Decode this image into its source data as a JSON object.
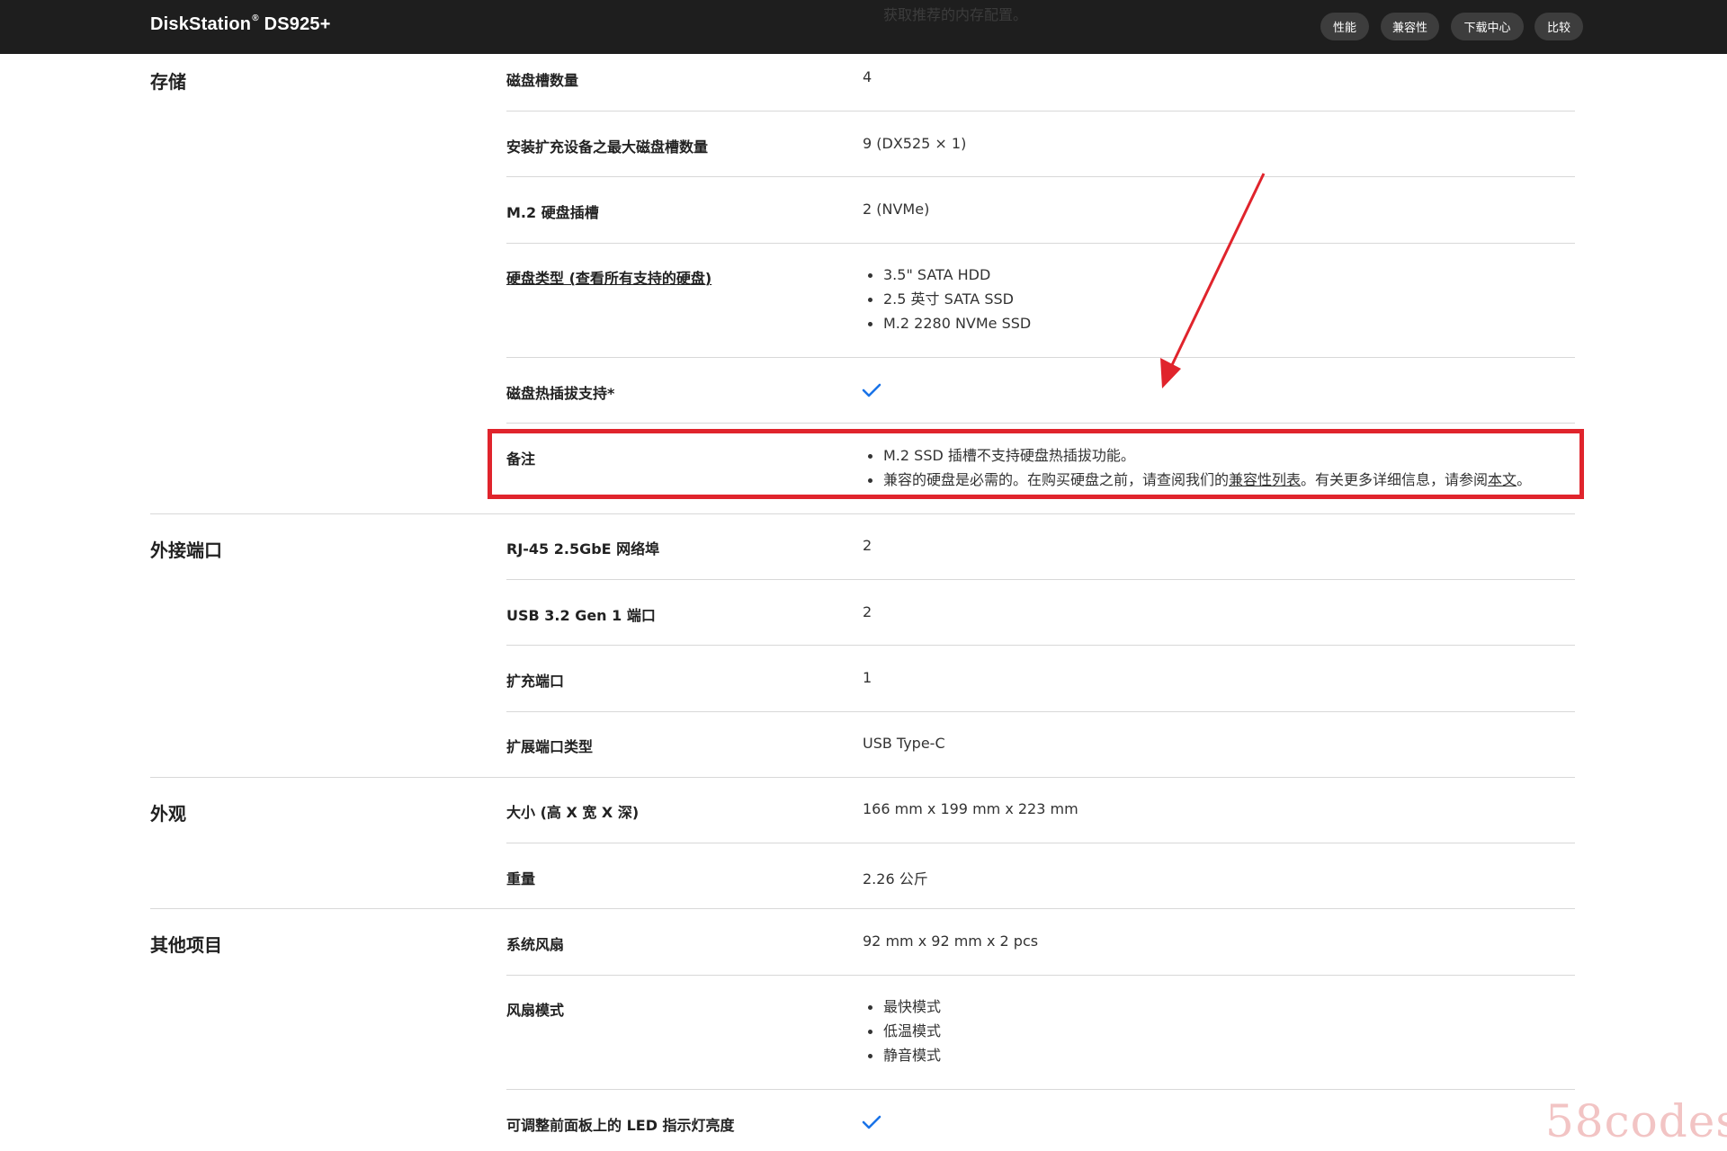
{
  "header": {
    "brand": "DiskStation",
    "brand_mark": "®",
    "brand_model": "DS925+",
    "overlay_text": "获取推荐的内存配置。",
    "nav": [
      "性能",
      "兼容性",
      "下载中心",
      "比较"
    ]
  },
  "sections": {
    "storage": {
      "title": "存储",
      "rows": {
        "slots": {
          "label": "磁盘槽数量",
          "value": "4"
        },
        "max_slots": {
          "label": "安装扩充设备之最大磁盘槽数量",
          "value": "9 (DX525 × 1)"
        },
        "m2": {
          "label": "M.2 硬盘插槽",
          "value": "2 (NVMe)"
        },
        "drive_type": {
          "label": "硬盘类型 (查看所有支持的硬盘)",
          "items": [
            "3.5\" SATA HDD",
            "2.5 英寸 SATA SSD",
            "M.2 2280 NVMe SSD"
          ]
        },
        "hot_swap": {
          "label": "磁盘热插拔支持*",
          "value_icon": "check-icon"
        },
        "notes": {
          "label": "备注",
          "note1": "M.2 SSD 插槽不支持硬盘热插拔功能。",
          "note2_pre": "兼容的硬盘是必需的。在购买硬盘之前，请查阅我们的",
          "note2_link": "兼容性列表",
          "note2_mid": "。有关更多详细信息，请参阅",
          "note2_link2": "本文",
          "note2_end": "。"
        }
      }
    },
    "ports": {
      "title": "外接端口",
      "rows": {
        "rj45": {
          "label": "RJ-45 2.5GbE 网络埠",
          "value": "2"
        },
        "usb": {
          "label": "USB 3.2 Gen 1 端口",
          "value": "2"
        },
        "expansion": {
          "label": "扩充端口",
          "value": "1"
        },
        "expansion_type": {
          "label": "扩展端口类型",
          "value": "USB Type-C"
        }
      }
    },
    "appearance": {
      "title": "外观",
      "rows": {
        "size": {
          "label": "大小 (高 X 宽 X 深)",
          "value": "166 mm x 199 mm x 223 mm"
        },
        "weight": {
          "label": "重量",
          "value": "2.26 公斤"
        }
      }
    },
    "other": {
      "title": "其他项目",
      "rows": {
        "fan": {
          "label": "系统风扇",
          "value": "92 mm x 92 mm x 2 pcs"
        },
        "fan_mode": {
          "label": "风扇模式",
          "items": [
            "最快模式",
            "低温模式",
            "静音模式"
          ]
        },
        "led": {
          "label": "可调整前面板上的 LED 指示灯亮度",
          "value_icon": "check-icon"
        }
      }
    }
  },
  "watermark": "58codes",
  "colors": {
    "accent_check": "#1a73e8",
    "highlight": "#e0242c",
    "header_bg": "#1e1e1e"
  }
}
